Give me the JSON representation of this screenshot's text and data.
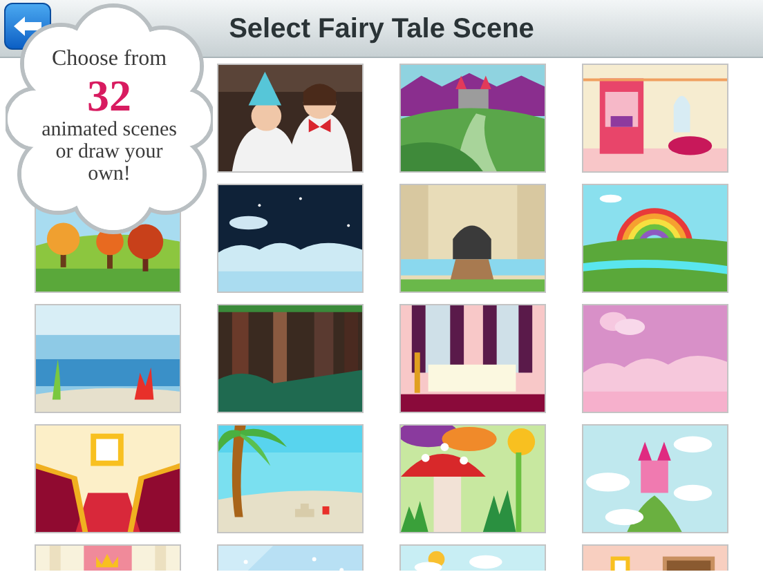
{
  "header": {
    "title": "Select Fairy Tale Scene",
    "back_button": {
      "kind": "back"
    }
  },
  "promo": {
    "lead": "Choose from",
    "number": "32",
    "text": "animated scenes or draw your own!"
  }
}
